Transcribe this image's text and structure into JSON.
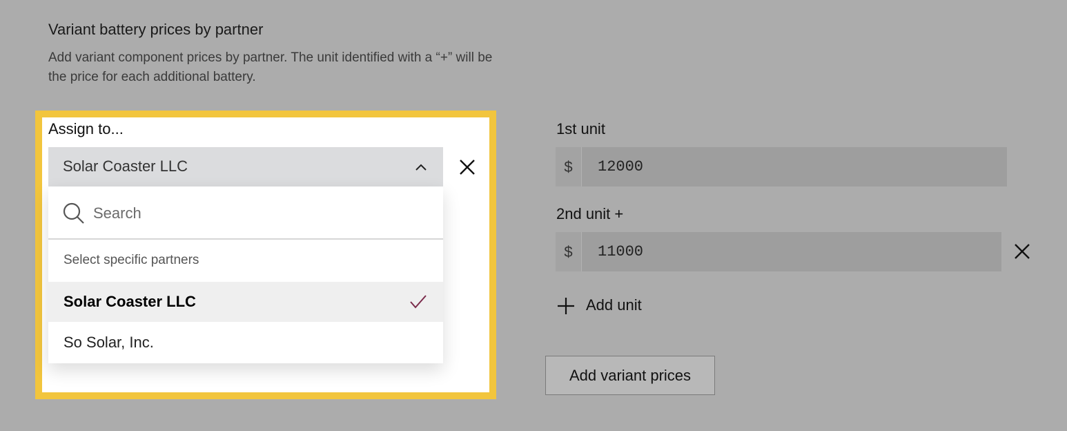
{
  "section": {
    "title": "Variant battery prices by partner",
    "description": "Add variant component prices by partner. The unit identified with a “+” will be the price for each additional battery."
  },
  "assign": {
    "label": "Assign to...",
    "selected": "Solar Coaster LLC",
    "dropdown": {
      "search_placeholder": "Search",
      "group_label": "Select specific partners",
      "options": [
        {
          "label": "Solar Coaster LLC",
          "selected": true
        },
        {
          "label": "So Solar, Inc.",
          "selected": false
        }
      ]
    }
  },
  "units": [
    {
      "label": "1st unit",
      "currency": "$",
      "value": "12000"
    },
    {
      "label": "2nd unit +",
      "currency": "$",
      "value": "11000"
    }
  ],
  "actions": {
    "add_unit": "Add unit",
    "add_variant_prices": "Add variant prices"
  },
  "colors": {
    "page_background": "#acacac",
    "highlight_border": "#f2c53d",
    "check_accent": "#7a2a4a"
  },
  "icons": [
    "chevron-up-icon",
    "close-icon",
    "search-icon",
    "check-icon",
    "plus-icon"
  ]
}
